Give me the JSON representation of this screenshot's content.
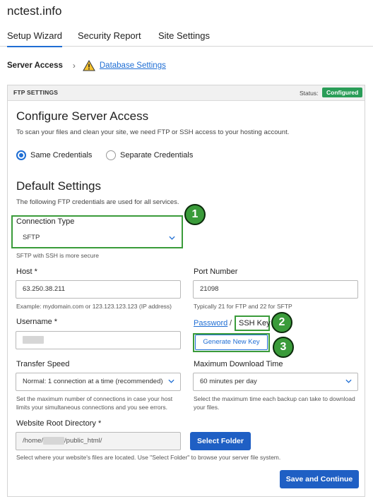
{
  "site": {
    "title": "nctest.info"
  },
  "tabs": [
    "Setup Wizard",
    "Security Report",
    "Site Settings"
  ],
  "breadcrumb": {
    "current": "Server Access",
    "separator": "›",
    "link": "Database Settings"
  },
  "panel": {
    "header": "FTP SETTINGS",
    "status_label": "Status:",
    "status_value": "Configured"
  },
  "access": {
    "heading": "Configure Server Access",
    "description": "To scan your files and clean your site, we need FTP or SSH access to your hosting account.",
    "options": [
      "Same Credentials",
      "Separate Credentials"
    ],
    "selected": "Same Credentials"
  },
  "defaults": {
    "heading": "Default Settings",
    "description": "The following FTP credentials are used for all services."
  },
  "connection": {
    "label": "Connection Type",
    "value": "SFTP",
    "help": "SFTP with SSH is more secure"
  },
  "host": {
    "label": "Host *",
    "value": "63.250.38.211",
    "help": "Example: mydomain.com or 123.123.123.123 (IP address)"
  },
  "port": {
    "label": "Port Number",
    "value": "21098",
    "help": "Typically 21 for FTP and 22 for SFTP"
  },
  "username": {
    "label": "Username *"
  },
  "auth": {
    "password": "Password",
    "slash": "/",
    "ssh_key": "SSH Key",
    "generate": "Generate New Key"
  },
  "speed": {
    "label": "Transfer Speed",
    "value": "Normal: 1 connection at a time (recommended)",
    "help": "Set the maximum number of connections in case your host limits your simultaneous connections and you see errors."
  },
  "download": {
    "label": "Maximum Download Time",
    "value": "60 minutes per day",
    "help": "Select the maximum time each backup can take to download your files."
  },
  "root": {
    "label": "Website Root Directory *",
    "value_prefix": "/home/",
    "value_suffix": "/public_html/",
    "select_button": "Select Folder",
    "help": "Select where your website's files are located. Use \"Select Folder\" to browse your server file system."
  },
  "save_button": "Save and Continue",
  "markers": [
    "1",
    "2",
    "3"
  ],
  "colors": {
    "accent": "#1f6ed4",
    "status": "#2a9d58",
    "highlight": "#3a9b3a"
  },
  "icons": {
    "warning": "warning-icon",
    "chevron": "chevron-down-icon"
  }
}
